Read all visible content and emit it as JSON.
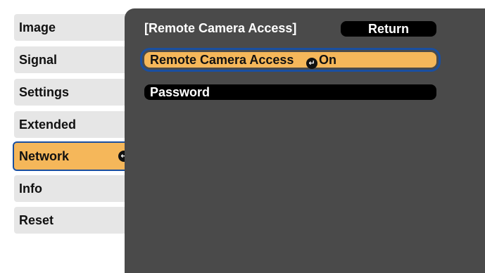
{
  "menu": {
    "items": [
      {
        "label": "Image"
      },
      {
        "label": "Signal"
      },
      {
        "label": "Settings"
      },
      {
        "label": "Extended"
      },
      {
        "label": "Network"
      },
      {
        "label": "Info"
      },
      {
        "label": "Reset"
      }
    ],
    "active_index": 4,
    "enter_icon": "enter-icon"
  },
  "panel": {
    "title": "[Remote Camera Access]",
    "return_label": "Return",
    "options": [
      {
        "label": "Remote Camera Access",
        "value": "On"
      },
      {
        "label": "Password"
      }
    ]
  },
  "colors": {
    "highlight": "#f5b75a",
    "focus_outline": "#1a4fa0",
    "panel_bg": "#4a4a4a",
    "menu_bg": "#e6e6e6"
  }
}
